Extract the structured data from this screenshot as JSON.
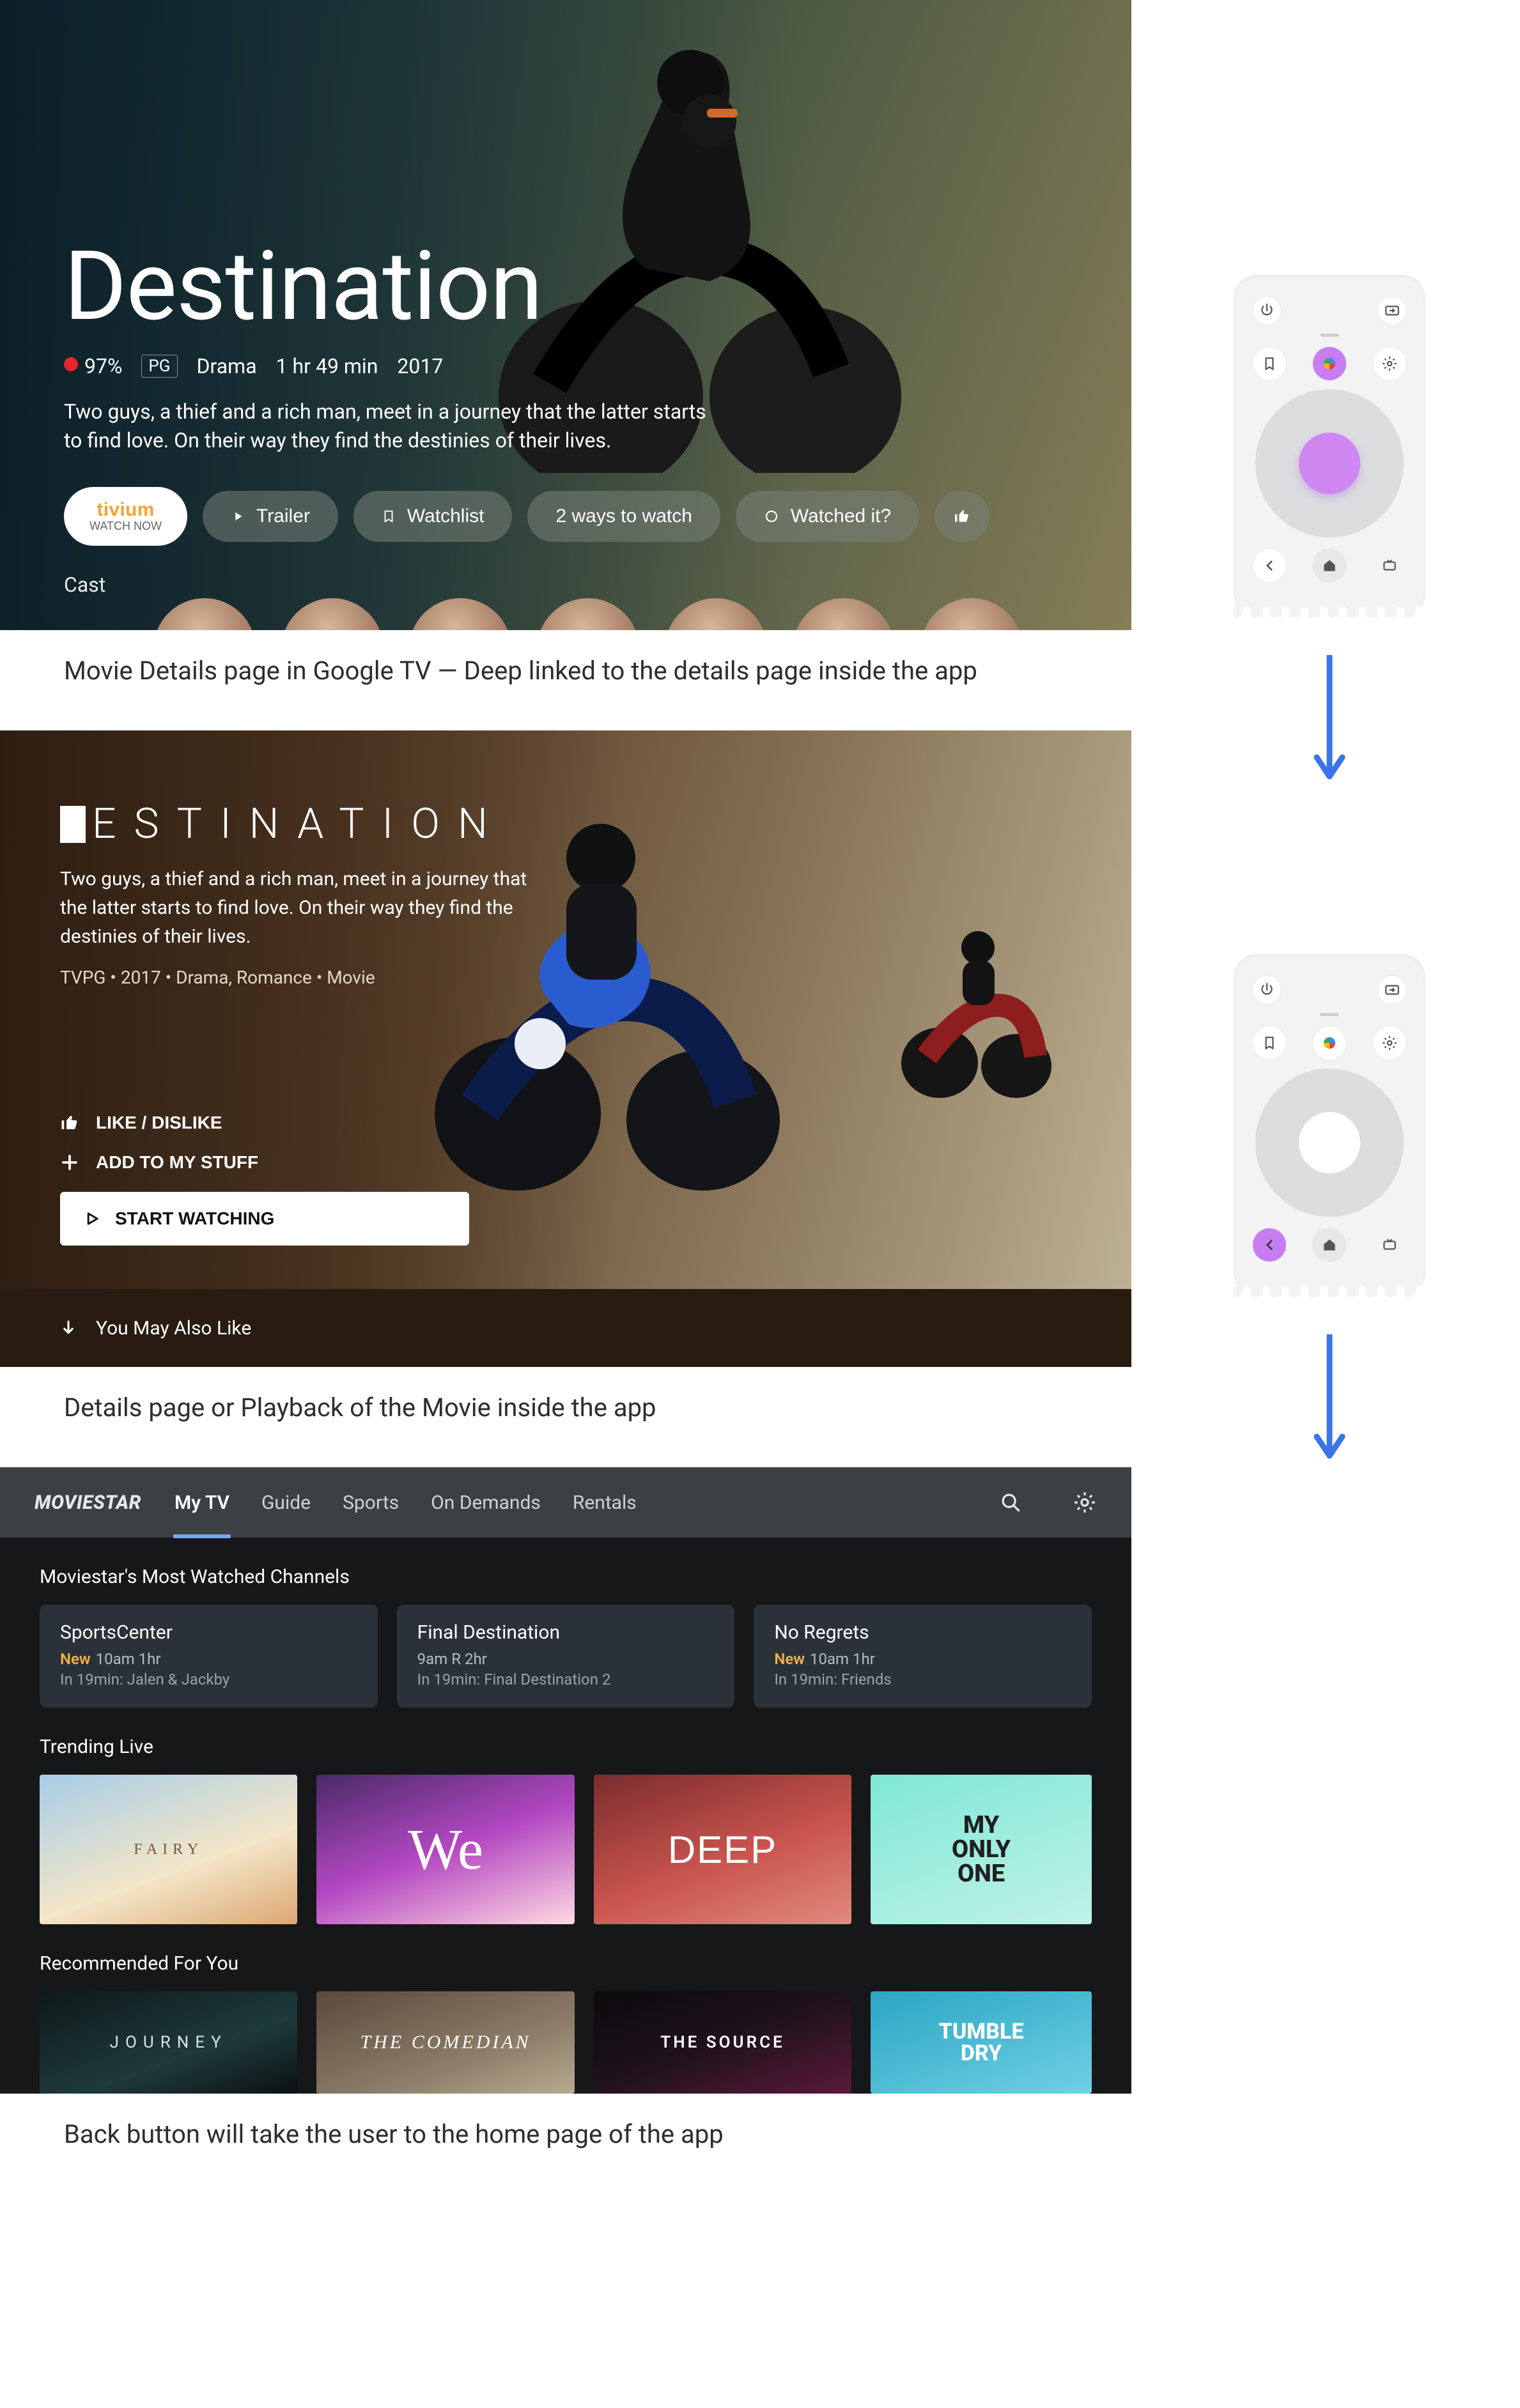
{
  "screen1": {
    "title": "Destination",
    "score": "97%",
    "rating": "PG",
    "genre": "Drama",
    "runtime": "1 hr 49 min",
    "year": "2017",
    "synopsis": "Two guys, a thief and a rich man, meet in a journey that the latter starts to find love. On their way they find the destinies of their lives.",
    "watch_now_brand": "tivium",
    "watch_now_sub": "WATCH NOW",
    "actions": {
      "trailer": "Trailer",
      "watchlist": "Watchlist",
      "ways": "2 ways to watch",
      "watched": "Watched it?"
    },
    "cast_label": "Cast"
  },
  "caption1": "Movie Details page in Google TV — Deep linked to the details page inside the app",
  "screen2": {
    "title": "ESTINATION",
    "synopsis": "Two guys, a thief and a rich man, meet in a journey that the latter starts to find love. On their way they find the destinies of their lives.",
    "tags": "TVPG • 2017 • Drama, Romance • Movie",
    "like": "LIKE / DISLIKE",
    "add": "ADD TO MY STUFF",
    "start": "START WATCHING",
    "ymal": "You May Also Like"
  },
  "caption2": "Details page or Playback of the Movie inside the app",
  "screen3": {
    "brand": "MOVIESTAR",
    "tabs": [
      "My TV",
      "Guide",
      "Sports",
      "On Demands",
      "Rentals"
    ],
    "active_tab": 0,
    "section1": "Moviestar's Most Watched Channels",
    "channels": [
      {
        "title": "SportsCenter",
        "line2_prefix": "New",
        "line2": "10am 1hr",
        "line3": "In 19min: Jalen & Jackby"
      },
      {
        "title": "Final Destination",
        "line2_prefix": "",
        "line2": "9am R 2hr",
        "line3": "In 19min: Final Destination 2"
      },
      {
        "title": "No Regrets",
        "line2_prefix": "New",
        "line2": "10am 1hr",
        "line3": "In 19min: Friends"
      }
    ],
    "section2": "Trending Live",
    "trending": [
      "FAIRY",
      "We",
      "DEEP",
      "MY ONLY ONE"
    ],
    "section3": "Recommended For You",
    "recommended": [
      "JOURNEY",
      "THE COMEDIAN",
      "THE SOURCE",
      "TUMBLE DRY"
    ]
  },
  "caption3": "Back button will take the user to the home page of the app",
  "remote": {
    "buttons": {
      "power": "power",
      "input": "input",
      "bookmark": "bookmark",
      "assistant": "assistant",
      "settings": "settings",
      "back": "back",
      "home": "home",
      "tv": "tv"
    }
  }
}
